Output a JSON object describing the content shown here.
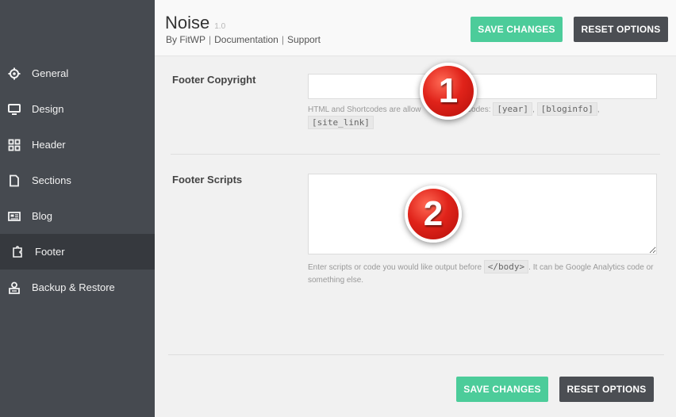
{
  "app": {
    "title": "Noise",
    "version": "1.0",
    "meta": {
      "by": "By FitWP",
      "documentation": "Documentation",
      "support": "Support",
      "separator": "|"
    }
  },
  "header_buttons": {
    "save": "SAVE CHANGES",
    "reset": "RESET OPTIONS"
  },
  "sidebar": {
    "items": [
      {
        "label": "General",
        "icon": "gear-icon"
      },
      {
        "label": "Design",
        "icon": "monitor-icon"
      },
      {
        "label": "Header",
        "icon": "grid-icon"
      },
      {
        "label": "Sections",
        "icon": "document-icon"
      },
      {
        "label": "Blog",
        "icon": "newspaper-icon"
      },
      {
        "label": "Footer",
        "icon": "footer-puzzle-icon"
      },
      {
        "label": "Backup & Restore",
        "icon": "backup-icon"
      }
    ],
    "active": "Footer"
  },
  "fields": {
    "copyright": {
      "label": "Footer Copyright",
      "value": "",
      "help_prefix": "HTML and Shortcodes are allow",
      "help_middle": "e shortcodes:",
      "codes": [
        "[year]",
        "[bloginfo]",
        "[site_link]"
      ],
      "comma": ","
    },
    "scripts": {
      "label": "Footer Scripts",
      "value": "",
      "help_before": "Enter scripts or code you would like output before",
      "help_code": "</body>",
      "help_after": ". It can be Google Analytics code or something else."
    }
  },
  "footer_buttons": {
    "save": "SAVE CHANGES",
    "reset": "RESET OPTIONS"
  },
  "badges": [
    "1",
    "2"
  ],
  "colors": {
    "sidebar_bg": "#464a50",
    "sidebar_active_bg": "#36393e",
    "accent_green": "#4ccc9a",
    "button_dark": "#4b4e53",
    "badge_red": "#e0231a"
  }
}
